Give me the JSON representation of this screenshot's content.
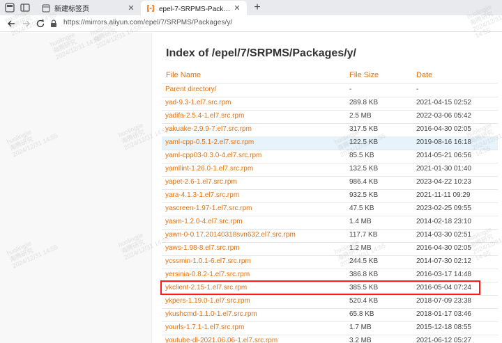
{
  "tabs": [
    {
      "title": "新建标签页",
      "active": false
    },
    {
      "title": "epel-7-SRPMS-Packages-y安装包",
      "active": true
    }
  ],
  "address_bar": {
    "url": "https://mirrors.aliyun.com/epel/7/SRPMS/Packages/y/"
  },
  "page": {
    "heading": "Index of /epel/7/SRPMS/Packages/y/",
    "columns": {
      "name": "File Name",
      "size": "File Size",
      "date": "Date"
    },
    "files": [
      {
        "name": "Parent directory/",
        "size": "-",
        "date": "-"
      },
      {
        "name": "yad-9.3-1.el7.src.rpm",
        "size": "289.8 KB",
        "date": "2021-04-15 02:52"
      },
      {
        "name": "yadifa-2.5.4-1.el7.src.rpm",
        "size": "2.5 MB",
        "date": "2022-03-06 05:42"
      },
      {
        "name": "yakuake-2.9.9-7.el7.src.rpm",
        "size": "317.5 KB",
        "date": "2016-04-30 02:05"
      },
      {
        "name": "yaml-cpp-0.5.1-2.el7.src.rpm",
        "size": "122.5 KB",
        "date": "2019-08-16 16:18",
        "highlighted": true
      },
      {
        "name": "yaml-cpp03-0.3.0-4.el7.src.rpm",
        "size": "85.5 KB",
        "date": "2014-05-21 06:56"
      },
      {
        "name": "yamllint-1.26.0-1.el7.src.rpm",
        "size": "132.5 KB",
        "date": "2021-01-30 01:40"
      },
      {
        "name": "yapet-2.6-1.el7.src.rpm",
        "size": "986.4 KB",
        "date": "2023-04-22 10:23"
      },
      {
        "name": "yara-4.1.3-1.el7.src.rpm",
        "size": "932.5 KB",
        "date": "2021-11-11 09:29"
      },
      {
        "name": "yascreen-1.97-1.el7.src.rpm",
        "size": "47.5 KB",
        "date": "2023-02-25 09:55"
      },
      {
        "name": "yasm-1.2.0-4.el7.src.rpm",
        "size": "1.4 MB",
        "date": "2014-02-18 23:10"
      },
      {
        "name": "yawn-0-0.17.20140318svn632.el7.src.rpm",
        "size": "117.7 KB",
        "date": "2014-03-30 02:51"
      },
      {
        "name": "yaws-1.98-8.el7.src.rpm",
        "size": "1.2 MB",
        "date": "2016-04-30 02:05"
      },
      {
        "name": "ycssmin-1.0.1-6.el7.src.rpm",
        "size": "244.5 KB",
        "date": "2014-07-30 02:12"
      },
      {
        "name": "yersinia-0.8.2-1.el7.src.rpm",
        "size": "386.8 KB",
        "date": "2016-03-17 14:48"
      },
      {
        "name": "ykclient-2.15-1.el7.src.rpm",
        "size": "385.5 KB",
        "date": "2016-05-04 07:24",
        "boxed": true
      },
      {
        "name": "ykpers-1.19.0-1.el7.src.rpm",
        "size": "520.4 KB",
        "date": "2018-07-09 23:38"
      },
      {
        "name": "ykushcmd-1.1.0-1.el7.src.rpm",
        "size": "65.8 KB",
        "date": "2018-01-17 03:46"
      },
      {
        "name": "yourls-1.7.1-1.el7.src.rpm",
        "size": "1.7 MB",
        "date": "2015-12-18 08:55"
      },
      {
        "name": "youtube-dl-2021.06.06-1.el7.src.rpm",
        "size": "3.2 MB",
        "date": "2021-06-12 05:27"
      }
    ]
  },
  "watermark": {
    "line1": "huolingjie",
    "line2": "海腾研究",
    "line3": "2024/12/31 14:55"
  },
  "colors": {
    "link": "#e4710f",
    "highlight_row": "#e7f3fb",
    "callout_box": "#ff1a1a"
  }
}
